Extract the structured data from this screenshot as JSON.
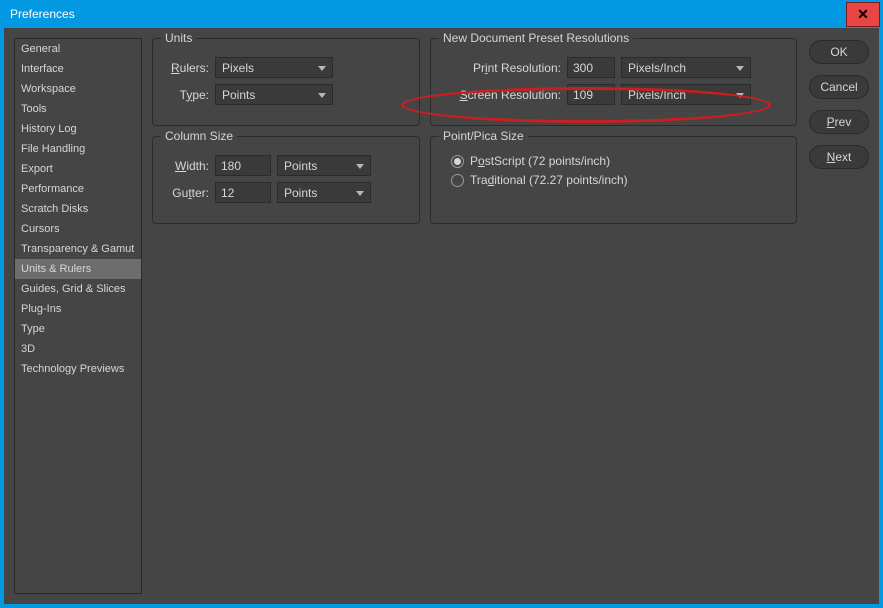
{
  "window": {
    "title": "Preferences"
  },
  "sidebar": {
    "items": [
      {
        "label": "General"
      },
      {
        "label": "Interface"
      },
      {
        "label": "Workspace"
      },
      {
        "label": "Tools"
      },
      {
        "label": "History Log"
      },
      {
        "label": "File Handling"
      },
      {
        "label": "Export"
      },
      {
        "label": "Performance"
      },
      {
        "label": "Scratch Disks"
      },
      {
        "label": "Cursors"
      },
      {
        "label": "Transparency & Gamut"
      },
      {
        "label": "Units & Rulers"
      },
      {
        "label": "Guides, Grid & Slices"
      },
      {
        "label": "Plug-Ins"
      },
      {
        "label": "Type"
      },
      {
        "label": "3D"
      },
      {
        "label": "Technology Previews"
      }
    ],
    "selected_index": 11
  },
  "units": {
    "legend": "Units",
    "rulers_label": "Rulers:",
    "rulers_value": "Pixels",
    "type_label": "Type:",
    "type_value": "Points"
  },
  "resolutions": {
    "legend": "New Document Preset Resolutions",
    "print_label": "Print Resolution:",
    "print_value": "300",
    "print_unit": "Pixels/Inch",
    "screen_label": "Screen Resolution:",
    "screen_value": "109",
    "screen_unit": "Pixels/Inch"
  },
  "column": {
    "legend": "Column Size",
    "width_label": "Width:",
    "width_value": "180",
    "width_unit": "Points",
    "gutter_label": "Gutter:",
    "gutter_value": "12",
    "gutter_unit": "Points"
  },
  "pointpica": {
    "legend": "Point/Pica Size",
    "postscript_label": "PostScript (72 points/inch)",
    "traditional_label": "Traditional (72.27 points/inch)",
    "selected": "postscript"
  },
  "buttons": {
    "ok": "OK",
    "cancel": "Cancel",
    "prev": "Prev",
    "next": "Next"
  }
}
